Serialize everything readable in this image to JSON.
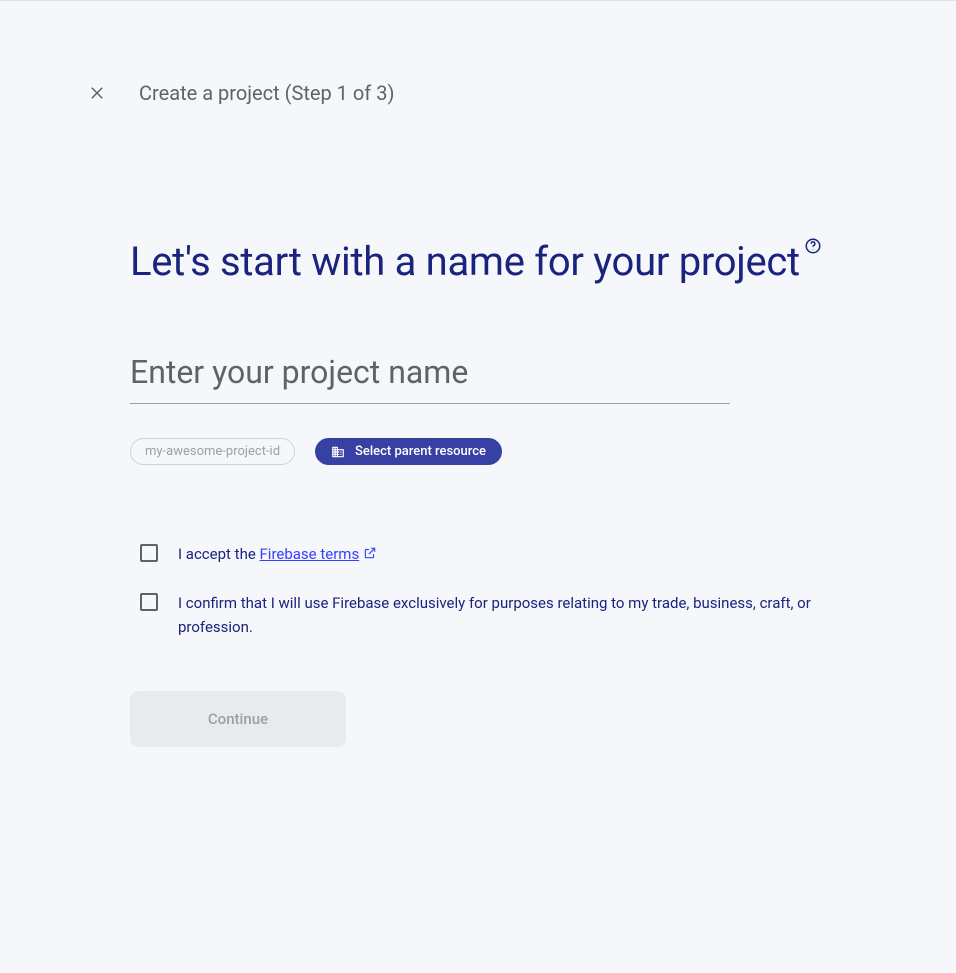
{
  "header": {
    "title": "Create a project (Step 1 of 3)"
  },
  "main": {
    "heading": "Let's start with a name for your project",
    "input": {
      "placeholder": "Enter your project name",
      "value": ""
    },
    "project_id_chip": "my-awesome-project-id",
    "parent_resource_button": "Select parent resource"
  },
  "checks": {
    "accept_prefix": "I accept the ",
    "accept_link": "Firebase terms",
    "confirm": "I confirm that I will use Firebase exclusively for purposes relating to my trade, business, craft, or profession."
  },
  "actions": {
    "continue": "Continue"
  }
}
